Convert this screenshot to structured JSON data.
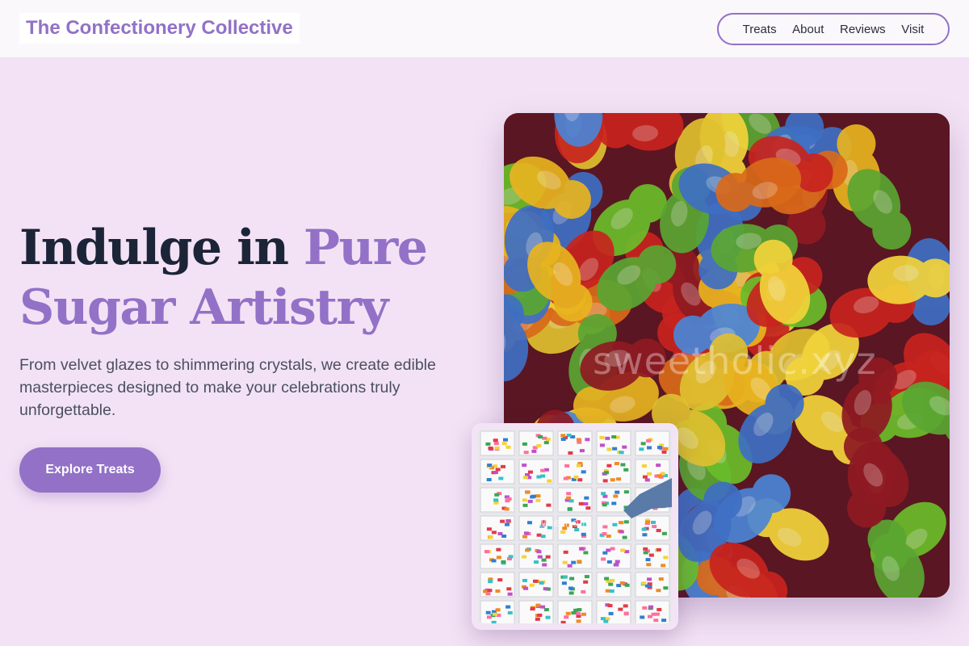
{
  "header": {
    "logo": "The Confectionery Collective",
    "nav": [
      "Treats",
      "About",
      "Reviews",
      "Visit"
    ]
  },
  "hero": {
    "title_part1": "Indulge in ",
    "title_accent1": "Pure",
    "title_accent2": "Sugar Artistry",
    "description": "From velvet glazes to shimmering crystals, we create edible masterpieces designed to make your celebrations truly unforgettable.",
    "cta_label": "Explore Treats"
  },
  "images": {
    "main_watermark": "sweetholic.xyz",
    "sub_watermark": "sweetholic"
  },
  "colors": {
    "accent": "#9271c7",
    "background": "#f3e2f5",
    "heading": "#1c2438"
  }
}
